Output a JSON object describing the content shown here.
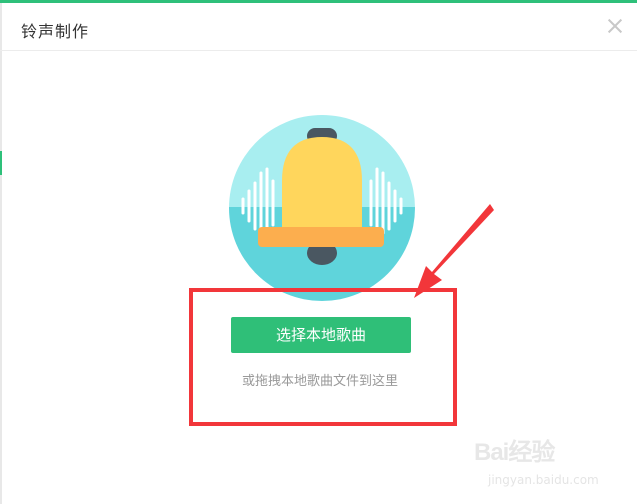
{
  "dialog": {
    "title": "铃声制作",
    "close_icon": "close-icon"
  },
  "main": {
    "illustration_icon": "bell-icon",
    "select_button_label": "选择本地歌曲",
    "drag_hint": "或拖拽本地歌曲文件到这里"
  },
  "watermark": {
    "brand": "Bai经验",
    "url": "jingyan.baidu.com"
  },
  "colors": {
    "accent": "#2ec07a",
    "annotation": "#f2363a",
    "circle_top": "#a8eef0",
    "circle_bottom": "#5fd4db",
    "bell": "#ffd65c",
    "bell_rim": "#fcae4e",
    "bell_knob": "#4a5761"
  }
}
